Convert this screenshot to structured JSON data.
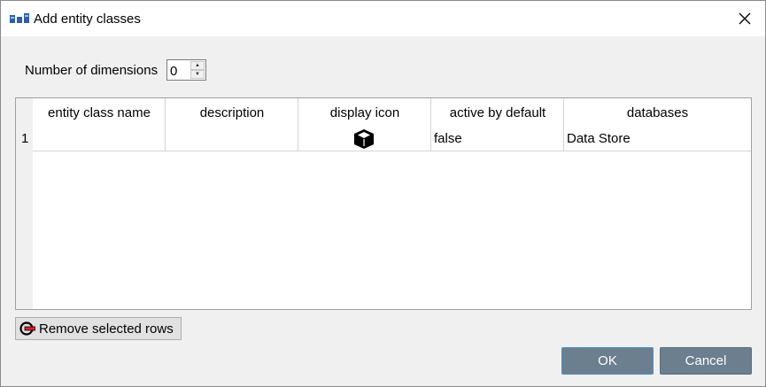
{
  "window": {
    "title": "Add entity classes",
    "close_icon": "close-icon",
    "app_icon": "entity-classes-icon"
  },
  "dimensions": {
    "label": "Number of dimensions",
    "value": "0"
  },
  "table": {
    "columns": [
      "entity class name",
      "description",
      "display icon",
      "active by default",
      "databases"
    ],
    "rows": [
      {
        "number": "1",
        "entity_class_name": "",
        "description": "",
        "display_icon": "cube-icon",
        "active_by_default": "false",
        "databases": "Data Store"
      }
    ]
  },
  "buttons": {
    "remove_label": "Remove selected rows",
    "ok_label": "OK",
    "cancel_label": "Cancel"
  },
  "colors": {
    "accent_button": "#6b7f8e",
    "focus_border": "#4a90d0"
  }
}
